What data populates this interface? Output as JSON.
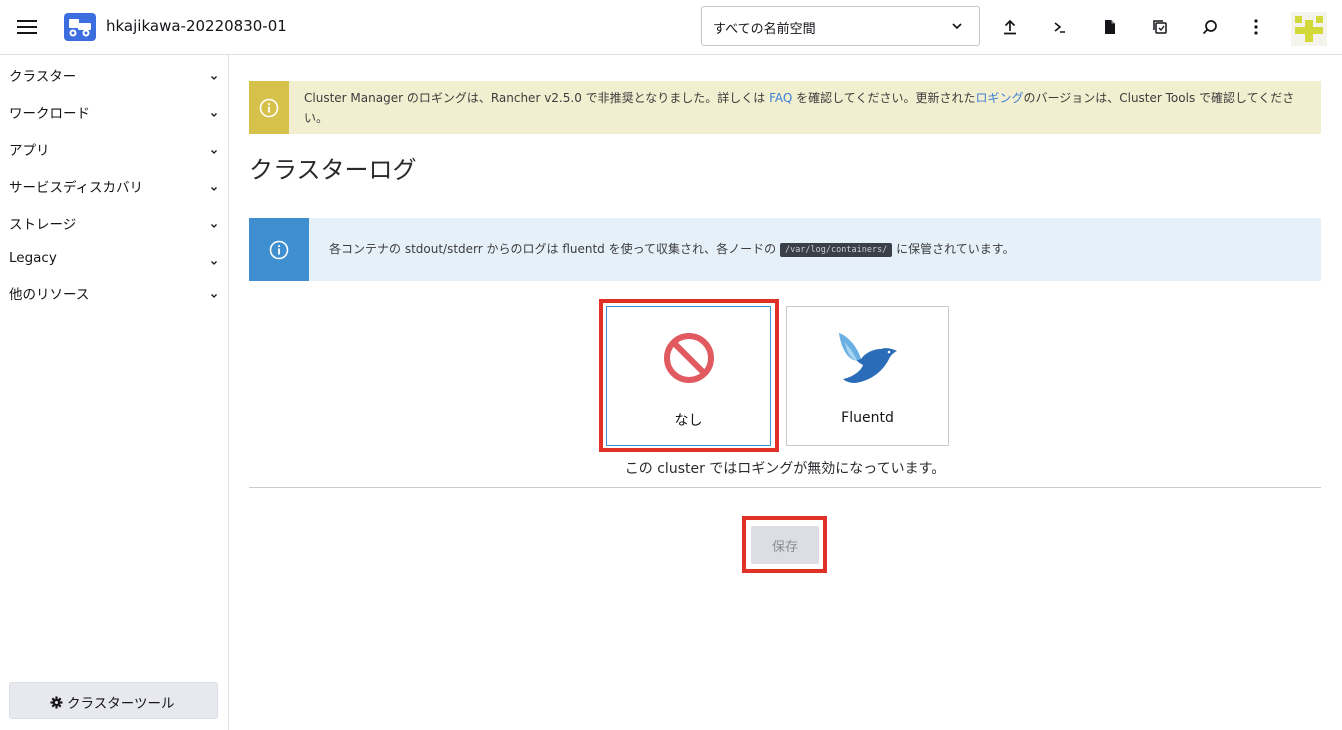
{
  "header": {
    "cluster_name": "hkajikawa-20220830-01",
    "namespace_select": "すべての名前空間",
    "icons": [
      "hamburger-menu-icon",
      "cluster-icon",
      "upload-icon",
      "terminal-icon",
      "file-icon",
      "copy-config-icon",
      "search-icon",
      "more-vertical-icon",
      "user-avatar"
    ]
  },
  "sidebar": {
    "items": [
      {
        "label": "クラスター"
      },
      {
        "label": "ワークロード"
      },
      {
        "label": "アプリ"
      },
      {
        "label": "サービスディスカバリ"
      },
      {
        "label": "ストレージ"
      },
      {
        "label": "Legacy"
      },
      {
        "label": "他のリソース"
      }
    ],
    "tools_button": "クラスターツール"
  },
  "banner_warning": {
    "text_1": "Cluster Manager のロギングは、Rancher v2.5.0 で非推奨となりました。詳しくは ",
    "link_faq": "FAQ",
    "text_2": " を確認してください。更新された",
    "link_logging": "ロギング",
    "text_3": "のバージョンは、Cluster Tools で確認してください。"
  },
  "page_title": "クラスターログ",
  "banner_info": {
    "text_1": "各コンテナの stdout/stderr からのログは fluentd を使って収集され、各ノードの ",
    "code": "/var/log/containers/",
    "text_2": " に保管されています。"
  },
  "options": {
    "none": {
      "label": "なし",
      "selected": true
    },
    "fluentd": {
      "label": "Fluentd",
      "selected": false
    }
  },
  "status_text": "この cluster ではロギングが無効になっています。",
  "save_button": "保存",
  "colors": {
    "accent_blue": "#3d91d0",
    "warning_yellow": "#d6c24a",
    "highlight_red": "#e13026",
    "cluster_badge": "#3d6ee0"
  }
}
